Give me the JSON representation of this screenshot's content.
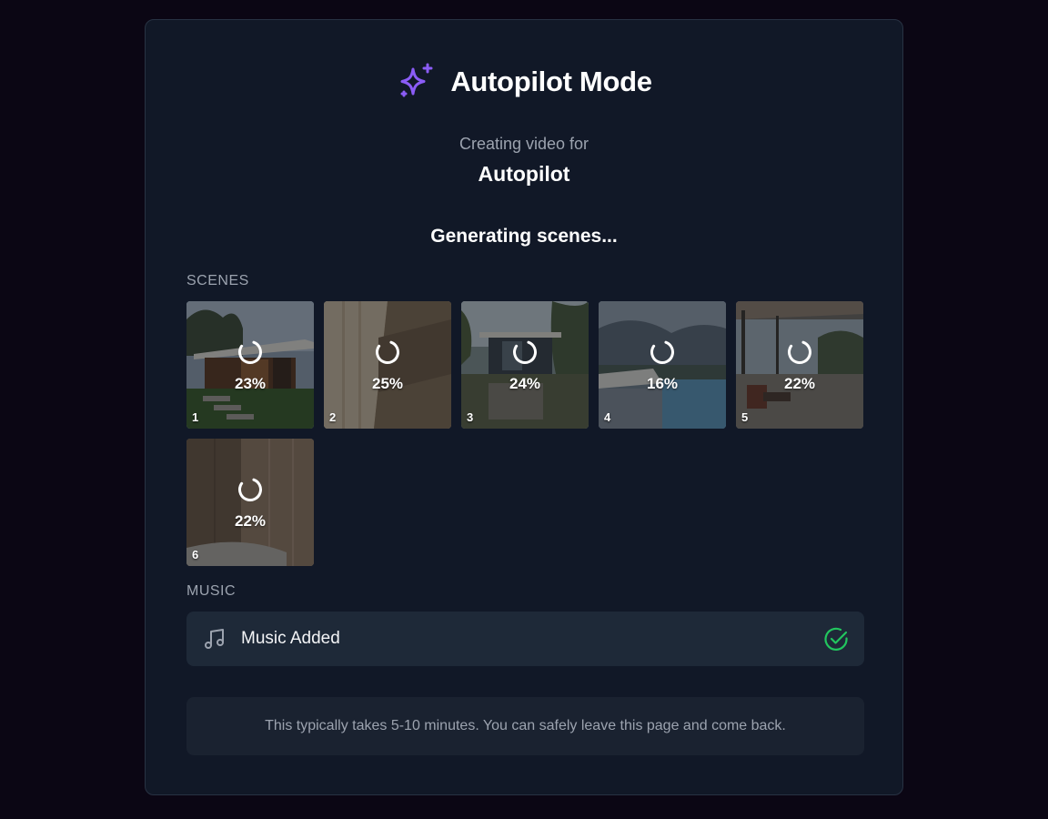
{
  "header": {
    "title": "Autopilot Mode",
    "icon": "sparkles-icon",
    "icon_color": "#8b5cf6"
  },
  "subtitle": "Creating video for",
  "project_name": "Autopilot",
  "status": "Generating scenes...",
  "scenes_section": {
    "label": "SCENES",
    "scenes": [
      {
        "number": "1",
        "progress_label": "23%",
        "progress": 0.23,
        "thumbnail": "modern house exterior with lawn"
      },
      {
        "number": "2",
        "progress_label": "25%",
        "progress": 0.25,
        "thumbnail": "wooden interior wall"
      },
      {
        "number": "3",
        "progress_label": "24%",
        "progress": 0.24,
        "thumbnail": "house entrance with garden"
      },
      {
        "number": "4",
        "progress_label": "16%",
        "progress": 0.16,
        "thumbnail": "infinity pool with loungers"
      },
      {
        "number": "5",
        "progress_label": "22%",
        "progress": 0.22,
        "thumbnail": "covered patio with lounge chair"
      },
      {
        "number": "6",
        "progress_label": "22%",
        "progress": 0.22,
        "thumbnail": "wood panelled room"
      }
    ]
  },
  "music_section": {
    "label": "MUSIC",
    "item_label": "Music Added",
    "icon": "music-note-icon",
    "status_icon": "check-circle-icon",
    "status_color": "#22c55e"
  },
  "info_text": "This typically takes 5-10 minutes. You can safely leave this page and come back."
}
